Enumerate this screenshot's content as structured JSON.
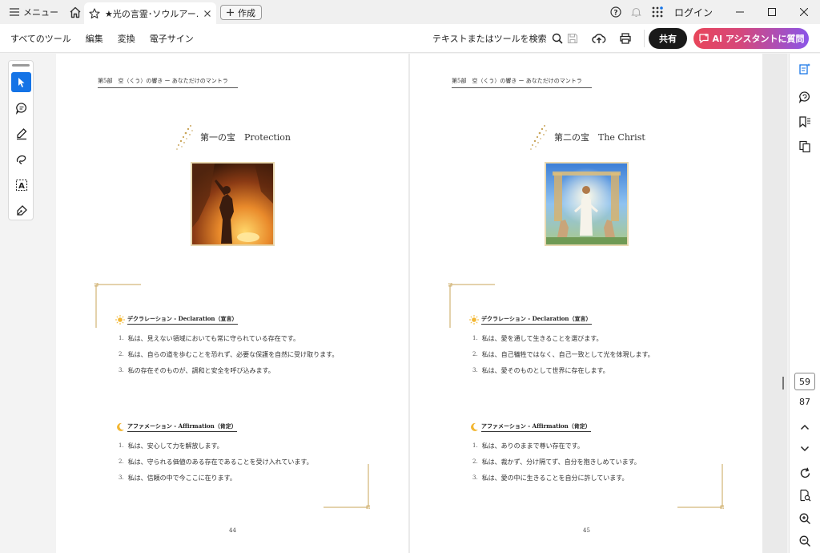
{
  "titlebar": {
    "menu_label": "メニュー",
    "tab_title": "★光の言霊･ソウルアー...",
    "new_tab_label": "作成",
    "login_label": "ログイン"
  },
  "toolbar": {
    "items": [
      "すべてのツール",
      "編集",
      "変換",
      "電子サイン"
    ],
    "search_label": "テキストまたはツールを検索",
    "share_label": "共有",
    "ai_label": "AI アシスタントに質問"
  },
  "left_page": {
    "header": "第5部　空（くう）の響き ー あなただけのマントラ",
    "treasure_title": "第一の宝　Protection",
    "declaration_title": "デクラレーション - Declaration（宣言）",
    "declarations": [
      "私は、見えない領域においても常に守られている存在です。",
      "私は、自らの道を歩むことを恐れず、必要な保護を自然に受け取ります。",
      "私の存在そのものが、調和と安全を呼び込みます。"
    ],
    "affirmation_title": "アファメーション - Affirmation（肯定）",
    "affirmations": [
      "私は、安心して力を解放します。",
      "私は、守られる価値のある存在であることを受け入れています。",
      "私は、信頼の中で今ここに在ります。"
    ],
    "page_number": "44"
  },
  "right_page": {
    "header": "第5部　空（くう）の響き ー あなただけのマントラ",
    "treasure_title": "第二の宝　The Christ",
    "declaration_title": "デクラレーション - Declaration（宣言）",
    "declarations": [
      "私は、愛を通して生きることを選びます。",
      "私は、自己犠牲ではなく、自己一致として光を体現します。",
      "私は、愛そのものとして世界に存在します。"
    ],
    "affirmation_title": "アファメーション - Affirmation（肯定）",
    "affirmations": [
      "私は、ありのままで尊い存在です。",
      "私は、裁かず、分け隔てず、自分を抱きしめています。",
      "私は、愛の中に生きることを自分に許しています。"
    ],
    "page_number": "45"
  },
  "navigation": {
    "current_page": "59",
    "total_pages": "87"
  },
  "colors": {
    "accent_blue": "#1473e6",
    "share_bg": "#1a1a1a",
    "ai_gradient_start": "#e8465a",
    "ai_gradient_end": "#8a55e8",
    "gold": "#c9a55a"
  }
}
